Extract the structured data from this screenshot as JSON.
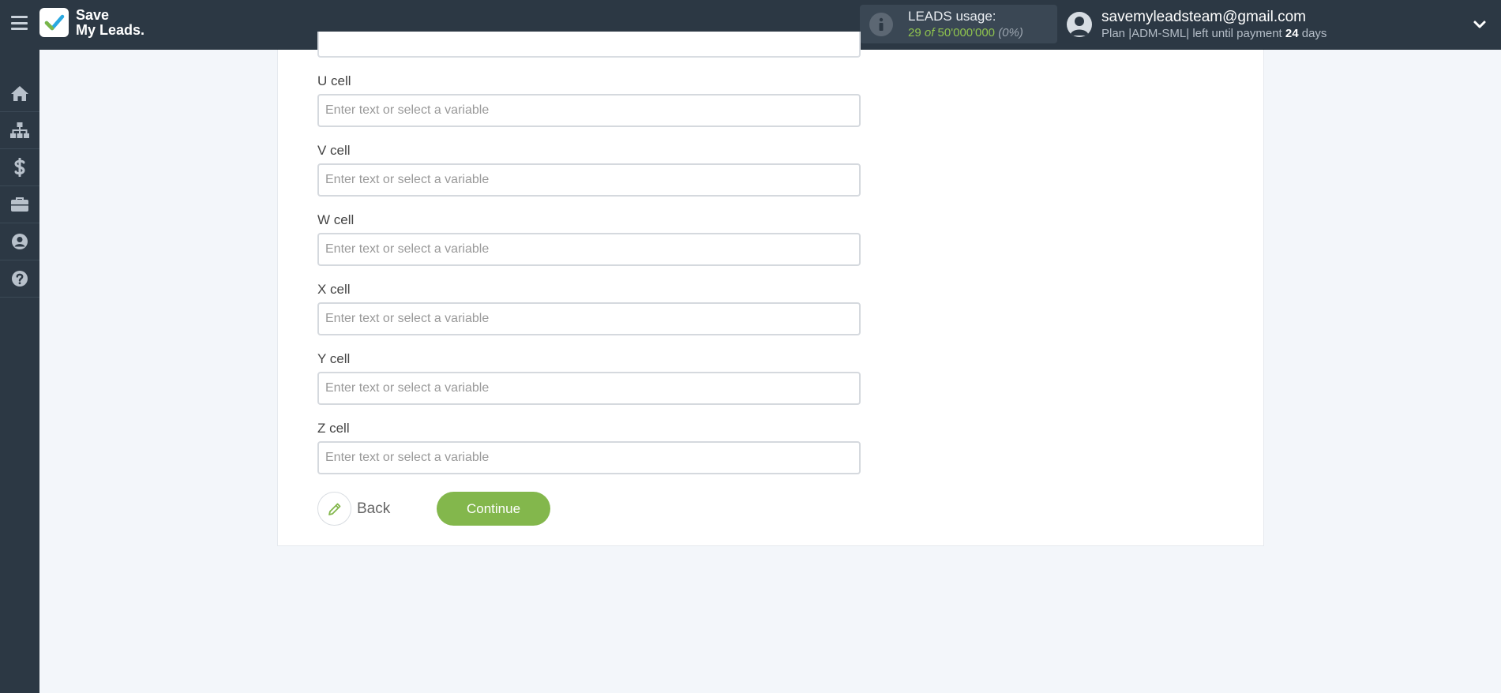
{
  "app": {
    "logo_line1": "Save",
    "logo_line2": "My Leads."
  },
  "usage": {
    "label": "LEADS usage:",
    "used": "29",
    "of": "of",
    "limit": "50'000'000",
    "percent": "(0%)"
  },
  "account": {
    "email": "savemyleadsteam@gmail.com",
    "plan_prefix": "Plan |ADM-SML| left until payment",
    "days": "24",
    "days_suffix": "days"
  },
  "sidebar": {
    "items": [
      {
        "icon": "home-icon"
      },
      {
        "icon": "sitemap-icon"
      },
      {
        "icon": "dollar-icon"
      },
      {
        "icon": "briefcase-icon"
      },
      {
        "icon": "user-circle-icon"
      },
      {
        "icon": "help-circle-icon"
      }
    ]
  },
  "form": {
    "fields": [
      {
        "label": "U cell",
        "placeholder": "Enter text or select a variable",
        "value": ""
      },
      {
        "label": "V cell",
        "placeholder": "Enter text or select a variable",
        "value": ""
      },
      {
        "label": "W cell",
        "placeholder": "Enter text or select a variable",
        "value": ""
      },
      {
        "label": "X cell",
        "placeholder": "Enter text or select a variable",
        "value": ""
      },
      {
        "label": "Y cell",
        "placeholder": "Enter text or select a variable",
        "value": ""
      },
      {
        "label": "Z cell",
        "placeholder": "Enter text or select a variable",
        "value": ""
      }
    ],
    "back_label": "Back",
    "continue_label": "Continue"
  },
  "colors": {
    "header_bg": "#2c3844",
    "accent_green": "#83b74c",
    "usage_green": "#8fc34e",
    "page_bg": "#f3f6fa"
  }
}
